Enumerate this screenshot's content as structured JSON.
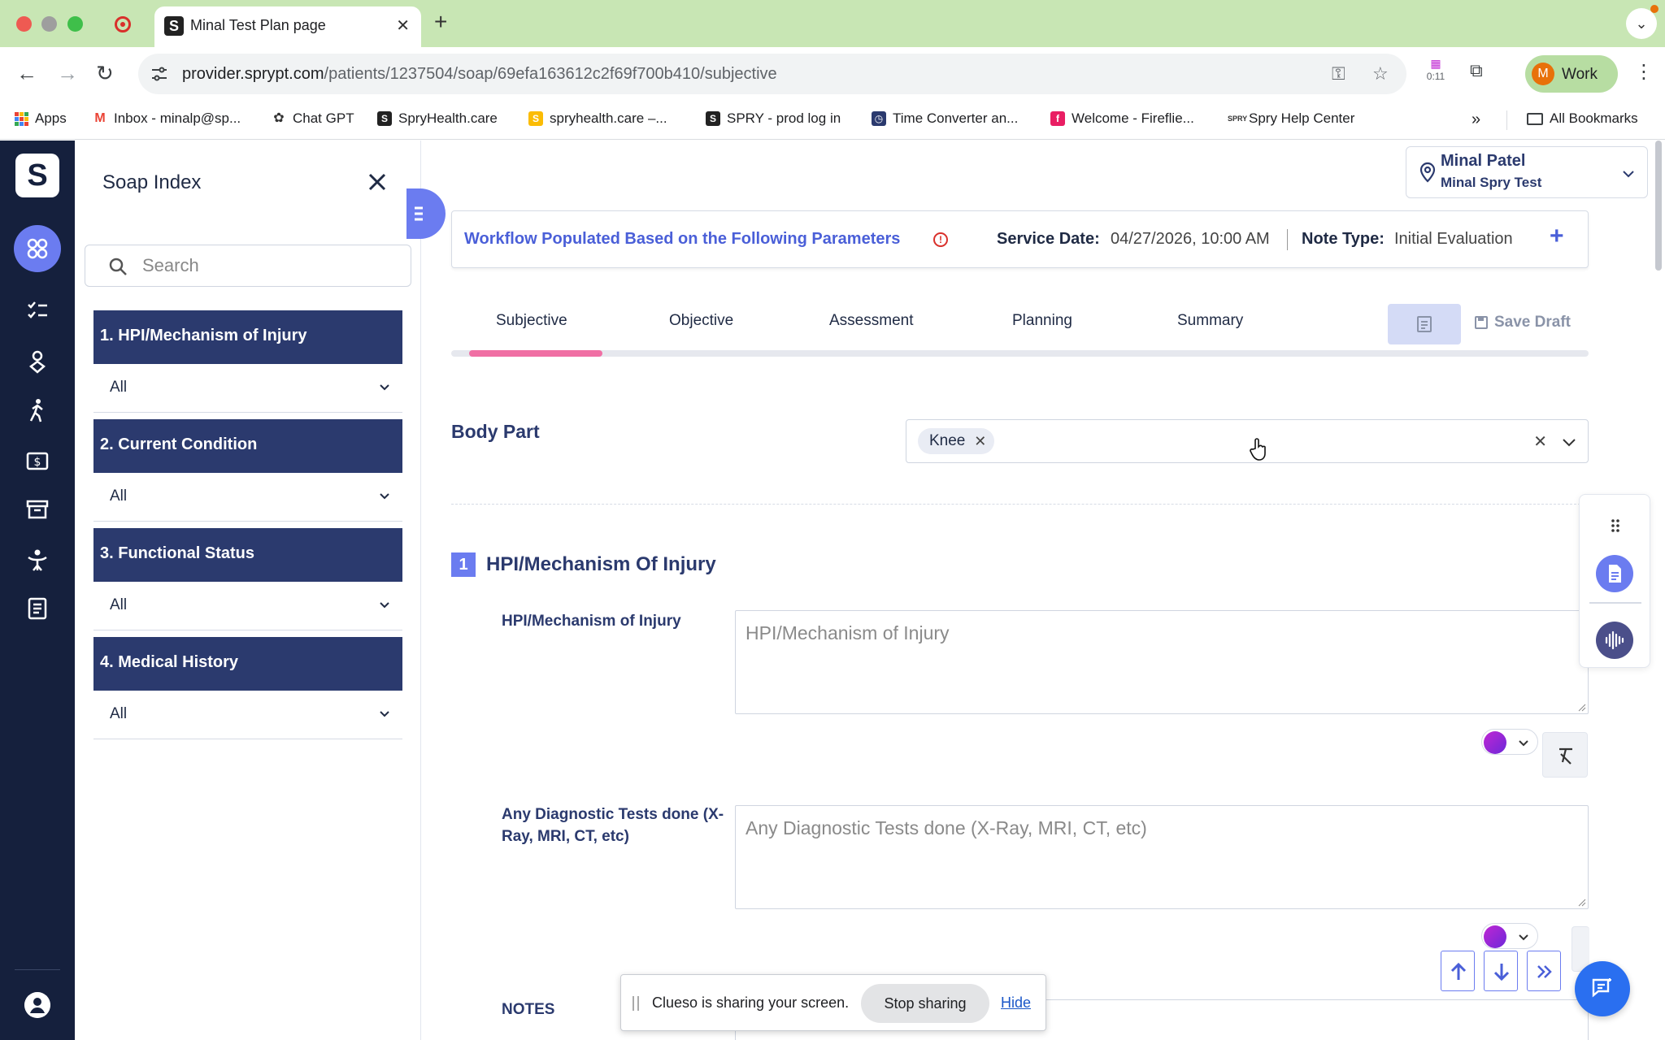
{
  "browser": {
    "tab_title": "Minal Test Plan page",
    "url_host": "provider.sprypt.com",
    "url_path": "/patients/1237504/soap/69efa163612c2f69f700b410/subjective",
    "extension_timer": "0:11",
    "profile_initial": "M",
    "profile_label": "Work",
    "bookmarks": [
      "Apps",
      "Inbox - minalp@sp...",
      "Chat GPT",
      "SpryHealth.care",
      "spryhealth.care –...",
      "SPRY - prod log in",
      "Time Converter an...",
      "Welcome - Fireflie...",
      "Spry Help Center"
    ],
    "all_bookmarks": "All Bookmarks"
  },
  "app": {
    "logo_letter": "S"
  },
  "soap_index": {
    "title": "Soap Index",
    "search_placeholder": "Search",
    "sections": [
      {
        "title": "1. HPI/Mechanism of Injury",
        "filter": "All"
      },
      {
        "title": "2. Current Condition",
        "filter": "All"
      },
      {
        "title": "3. Functional Status",
        "filter": "All"
      },
      {
        "title": "4. Medical History",
        "filter": "All"
      }
    ]
  },
  "provider": {
    "name": "Minal Patel",
    "location": "Minal Spry Test"
  },
  "workflow": {
    "title": "Workflow Populated Based on the Following Parameters",
    "service_date_label": "Service Date:",
    "service_date_value": "04/27/2026, 10:00 AM",
    "note_type_label": "Note Type:",
    "note_type_value": "Initial Evaluation"
  },
  "tabs": {
    "items": [
      "Subjective",
      "Objective",
      "Assessment",
      "Planning",
      "Summary"
    ],
    "active": "Subjective",
    "save_draft": "Save Draft"
  },
  "body_part": {
    "label": "Body Part",
    "selected": "Knee"
  },
  "section": {
    "number": "1",
    "title": "HPI/Mechanism Of Injury",
    "fields": [
      {
        "label": "HPI/Mechanism of Injury",
        "placeholder": "HPI/Mechanism of Injury"
      },
      {
        "label": "Any Diagnostic Tests done (X-Ray, MRI, CT, etc)",
        "placeholder": "Any Diagnostic Tests done (X-Ray, MRI, CT, etc)"
      }
    ],
    "notes_label": "NOTES"
  },
  "screen_share": {
    "text": "Clueso is sharing your screen.",
    "stop_label": "Stop sharing",
    "hide_label": "Hide"
  },
  "colors": {
    "rail": "#15203d",
    "section_header": "#2b3a6e",
    "accent": "#6b7cf0",
    "tab_indicator": "#f06fa4",
    "browser_chrome": "#c8e6b4"
  }
}
